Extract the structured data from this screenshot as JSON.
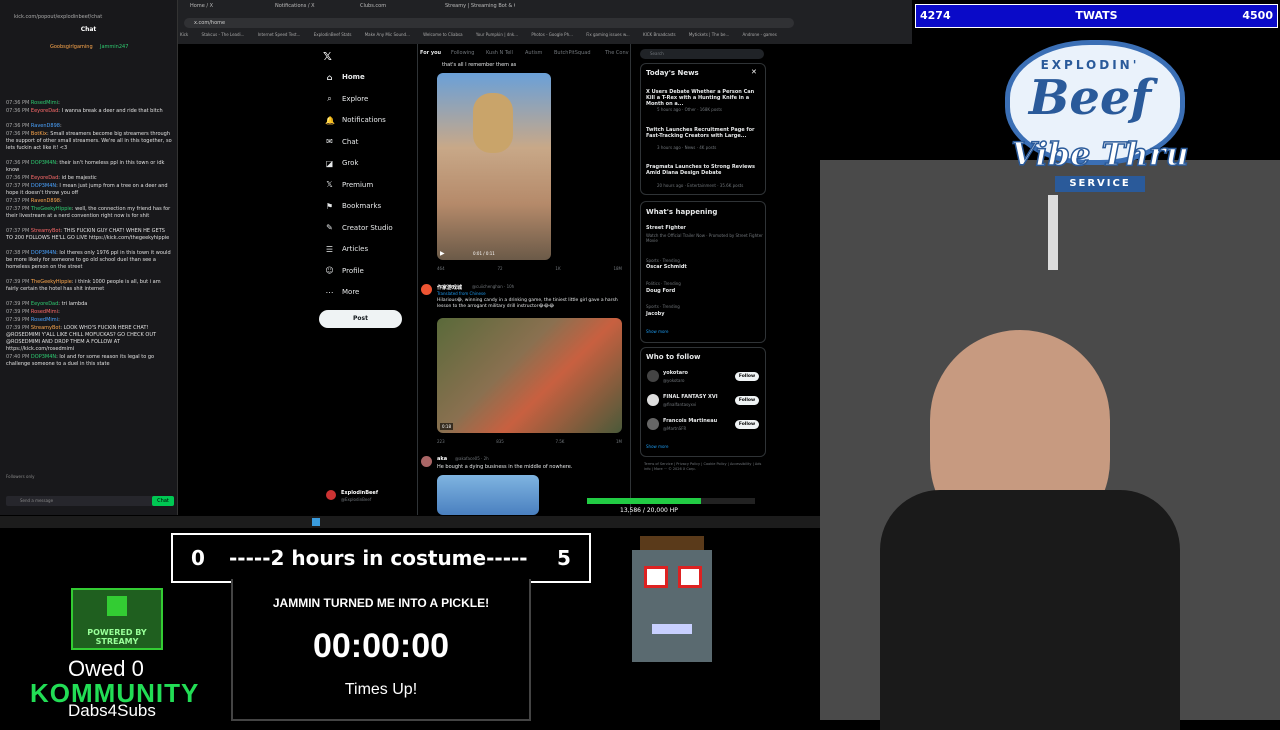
{
  "browser": {
    "tabs": [
      "Home / X",
      "Notifications / X",
      "Clubs.com",
      "Streamy | Streaming Bot & Ov..."
    ],
    "address": "x.com/home",
    "bookmarks": [
      "Kick",
      "Stakcus - The Leadi...",
      "Internet Speed Test...",
      "ExplodinBeef Stats",
      "Make Any Mic Sound...",
      "Welcome to Cliabsa",
      "Your Pumpkin | dnk...",
      "Photos - Google Ph...",
      "Fix gaming issues w...",
      "KICK Broadcasts",
      "Mytickets | The be...",
      "Androne - games"
    ],
    "chat_url": "kick.com/popout/explodinbeef/chat"
  },
  "chat": {
    "header": "Chat",
    "pinned_user": "Goobsgirlgaming",
    "pinned_user2": "Jammin247",
    "messages": [
      {
        "time": "07:36 PM",
        "user": "RosedMimi",
        "text": ""
      },
      {
        "time": "07:36 PM",
        "user": "EeyoreDad",
        "text": "I wanna break a deer and ride that bitch"
      },
      {
        "time": "07:36 PM",
        "user": "RavenD898",
        "text": ""
      },
      {
        "time": "07:36 PM",
        "user": "BotKix",
        "text": "Small streamers become big streamers through the support of other small streamers. We're all in this together, so lets fuckin act like it! <3"
      },
      {
        "time": "07:36 PM",
        "user": "DOP3M4N",
        "text": "their isn't homeless ppl in this town or idk know"
      },
      {
        "time": "07:36 PM",
        "user": "EeyoreDad",
        "text": "id be majestic"
      },
      {
        "time": "07:37 PM",
        "user": "DOP3M4N",
        "text": "I mean just jump from a tree on a deer and hope it doesn't throw you off"
      },
      {
        "time": "07:37 PM",
        "user": "RavenD898",
        "text": ""
      },
      {
        "time": "07:37 PM",
        "user": "TheGeekyHippie",
        "text": "well, the connection my friend has for their livestream at a nerd convention right now is for shit"
      },
      {
        "time": "07:37 PM",
        "user": "StreamyBot",
        "text": "THIS FUCKIN GUY CHAT! WHEN HE GETS TO 200 FOLLOWS HE'LL GO LIVE https://kick.com/thegeekyhippie"
      },
      {
        "time": "07:38 PM",
        "user": "DOP3M4N",
        "text": "lol theres only 1976 ppl in this town it would be more likely for someone to go old school duel than see a homeless person on the street"
      },
      {
        "time": "07:39 PM",
        "user": "TheGeekyHippie",
        "text": "i think 1000 people is all, but i am fairly certain the hotel has shit internet"
      },
      {
        "time": "07:39 PM",
        "user": "EeyoreDad",
        "text": "tri lambda"
      },
      {
        "time": "07:39 PM",
        "user": "RosedMimi",
        "text": ""
      },
      {
        "time": "07:39 PM",
        "user": "RosedMimi",
        "text": ""
      },
      {
        "time": "07:39 PM",
        "user": "StreamyBot",
        "text": "LOOK WHO'S FUCKIN HERE CHAT! @ROSEDMIMI Y'ALL LIKE CHILL MOFUCKAS? GO CHECK OUT @ROSEDMIMI AND DROP THEM A FOLLOW AT https://kick.com/rosedmimi"
      },
      {
        "time": "07:40 PM",
        "user": "DOP3M4N",
        "text": "lol and for some reason its legal to go challenge someone to a duel in this state"
      }
    ],
    "input_placeholder": "Send a message",
    "send_label": "Chat",
    "footer": "Followers only"
  },
  "x": {
    "nav": [
      {
        "label": "Home",
        "icon": "home-icon"
      },
      {
        "label": "Explore",
        "icon": "search-icon"
      },
      {
        "label": "Notifications",
        "icon": "bell-icon"
      },
      {
        "label": "Chat",
        "icon": "chat-icon"
      },
      {
        "label": "Grok",
        "icon": "grok-icon"
      },
      {
        "label": "Premium",
        "icon": "x-premium-icon"
      },
      {
        "label": "Bookmarks",
        "icon": "bookmark-icon"
      },
      {
        "label": "Creator Studio",
        "icon": "creator-icon"
      },
      {
        "label": "Articles",
        "icon": "articles-icon"
      },
      {
        "label": "Profile",
        "icon": "profile-icon"
      },
      {
        "label": "More",
        "icon": "more-icon"
      }
    ],
    "post_label": "Post",
    "account_name": "ExplodinBeef",
    "account_handle": "@ExplodinBeef",
    "feed_tabs": [
      "For you",
      "Following",
      "Kush N Tell",
      "Autism",
      "ButchPitSquad",
      "The Conv"
    ],
    "feed_top_text": "that's all I remember them as",
    "video_time": "0:01 / 0:11",
    "post1_stats": [
      "464",
      "72",
      "1K",
      "18M"
    ],
    "post2_user": "作家游戏城",
    "post2_handle": "@cuiichenghan · 10h",
    "post2_translated": "Translated from Chinese",
    "post2_text": "Hilarious😂, winning candy in a drinking game, the tiniest little girl gave a harsh lesson to the arrogant military drill instructor😂😂😂",
    "post2_duration": "0:18",
    "post2_stats": [
      "223",
      "835",
      "7.5K",
      "1M"
    ],
    "post3_user": "aka",
    "post3_handle": "@akaface05 · 2h",
    "post3_text": "He bought a dying business in the middle of nowhere.",
    "search_placeholder": "Search",
    "todays_news_title": "Today's News",
    "news": [
      {
        "title": "X Users Debate Whether a Person Can Kill a T-Rex with a Hunting Knife in a Month on a...",
        "meta": "5 hours ago · Other · 168K posts"
      },
      {
        "title": "Twitch Launches Recruitment Page for Fast-Tracking Creators with Large...",
        "meta": "3 hours ago · News · 4K posts"
      },
      {
        "title": "Pragmata Launches to Strong Reviews Amid Diana Design Debate",
        "meta": "20 hours ago · Entertainment · 35.6K posts"
      }
    ],
    "happening_title": "What's happening",
    "trends": [
      {
        "name": "Street Fighter",
        "meta": "Watch the Official Trailer Now · Promoted by Street Fighter Movie"
      },
      {
        "name": "Oscar Schmidt",
        "meta": "Sports · Trending"
      },
      {
        "name": "Doug Ford",
        "meta": "Politics · Trending"
      },
      {
        "name": "Jacoby",
        "meta": "Sports · Trending"
      }
    ],
    "show_more": "Show more",
    "follow_title": "Who to follow",
    "who_to_follow": [
      {
        "name": "yokotaro",
        "handle": "@yokotaro"
      },
      {
        "name": "FINAL FANTASY XVI",
        "handle": "@finalfantasyxvi"
      },
      {
        "name": "Francois Martineau",
        "handle": "@MartnSFR"
      }
    ],
    "follow_label": "Follow",
    "footer_links": "Terms of Service | Privacy Policy | Cookie Policy | Accessibility | Ads info | More ··· © 2026 X Corp."
  },
  "overlay": {
    "top_left": "4274",
    "top_center": "TWATS",
    "top_right": "4500",
    "logo_top": "EXPLODIN'",
    "logo_main": "Beef",
    "logo_sub": "Vibe Thru",
    "logo_service": "SERVICE",
    "goal_left": "0",
    "goal_text": "-----2 hours in costume-----",
    "goal_right": "5",
    "timer_title": "JAMMIN TURNED ME INTO A PICKLE!",
    "timer": "00:00:00",
    "timer_status": "Times Up!",
    "streamy_label": "POWERED BY STREAMY",
    "owed": "Owed 0",
    "kommunity": "KOMMUNITY",
    "dabs": "Dabs4Subs",
    "xp_text": "13,586 / 20,000 HP",
    "xp_fraction": 0.68
  },
  "colors": {
    "accent_blue": "#0a0ac8",
    "kick_green": "#22dd55",
    "x_bg": "#000000"
  }
}
